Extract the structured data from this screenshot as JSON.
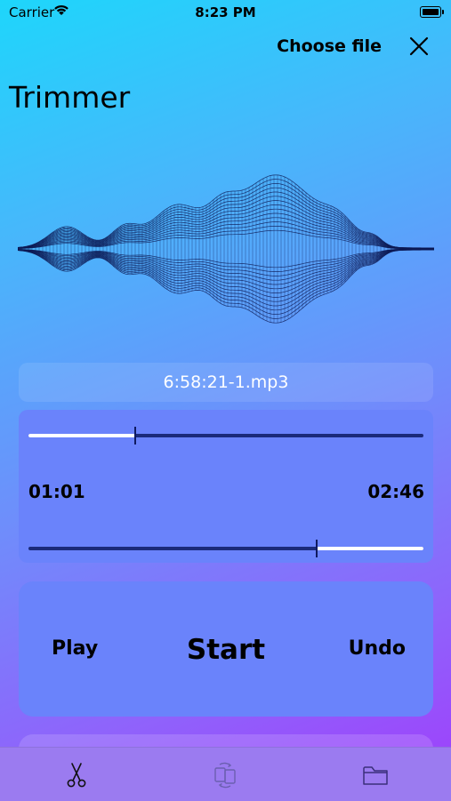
{
  "status_bar": {
    "carrier": "Carrier",
    "time": "8:23 PM"
  },
  "header": {
    "choose_file_label": "Choose file",
    "close_icon": "close-icon",
    "title": "Trimmer"
  },
  "waveform": {
    "icon": "waveform-graphic",
    "color": "#0d1a55"
  },
  "file": {
    "name": "6:58:21-1.mp3"
  },
  "trim": {
    "start_time": "01:01",
    "end_time": "02:46",
    "start_position": 0.27,
    "end_position": 0.73
  },
  "controls": {
    "play_label": "Play",
    "start_label": "Start",
    "undo_label": "Undo"
  },
  "tab_bar": {
    "tabs": [
      {
        "icon": "scissors-icon",
        "selected": true
      },
      {
        "icon": "convert-files-icon",
        "selected": false
      },
      {
        "icon": "folder-icon",
        "selected": false
      }
    ]
  },
  "colors": {
    "card": "#6a83fb",
    "track": "#1b2a7a",
    "tab_bar": "#9b7bf0"
  }
}
